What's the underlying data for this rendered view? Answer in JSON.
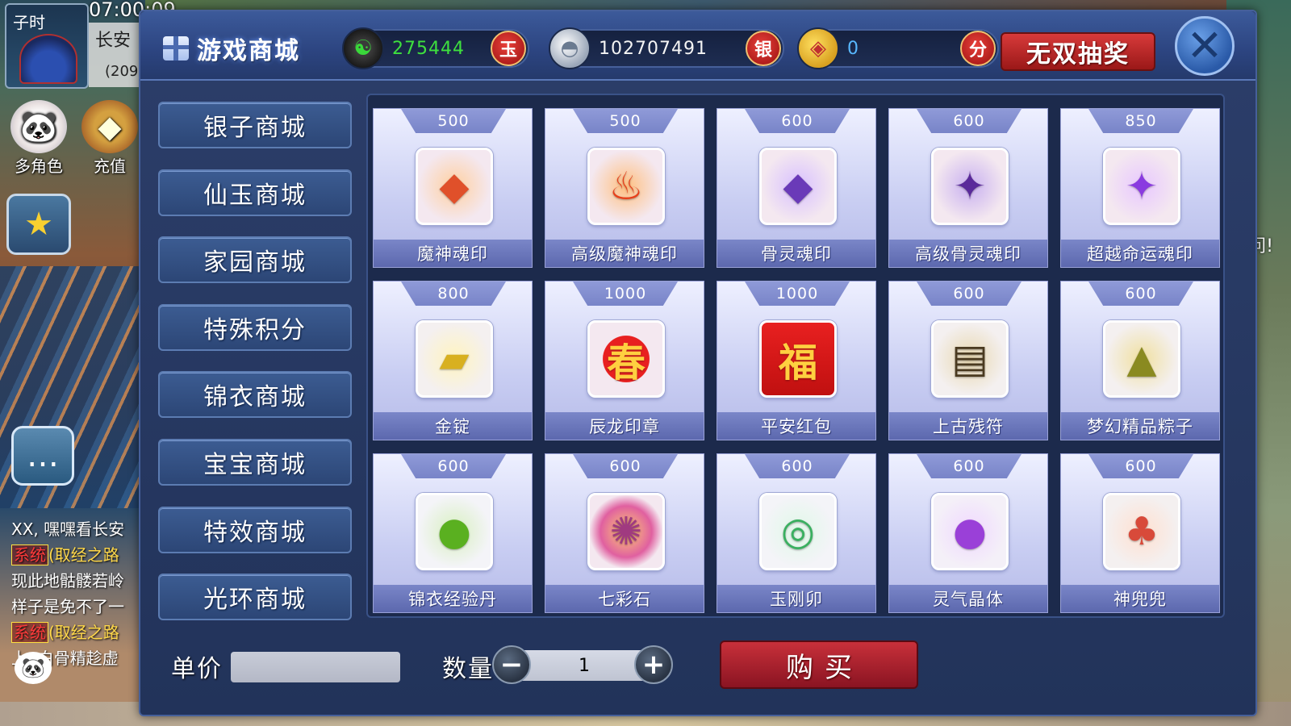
{
  "hud": {
    "time_period": "子时",
    "clock": "07:00:09",
    "city": "长安",
    "coords": "(209",
    "multi_role_label": "多角色",
    "recharge_label": "充值",
    "chat_lines": [
      {
        "text": "XX, 嘿嘿看长安"
      },
      {
        "tag": "系统",
        "text": "(取经之路"
      },
      {
        "text": "现此地骷髅若岭"
      },
      {
        "text": "样子是免不了一"
      },
      {
        "tag": "系统",
        "text": "(取经之路"
      },
      {
        "text": "上, 白骨精趁虚"
      }
    ],
    "right_text": "问!"
  },
  "mall": {
    "title": "游戏商城",
    "currencies": {
      "jade": {
        "value": "275444",
        "badge": "玉"
      },
      "silver": {
        "value": "102707491",
        "badge": "银"
      },
      "points": {
        "value": "0",
        "badge": "分"
      }
    },
    "lottery_label": "无双抽奖",
    "close_symbol": "✕",
    "nav": [
      "银子商城",
      "仙玉商城",
      "家园商城",
      "特殊积分",
      "锦衣商城",
      "宝宝商城",
      "特效商城",
      "光环商城"
    ],
    "items": [
      {
        "price": "500",
        "name": "魔神魂印",
        "icon": "red-soul-seal-icon"
      },
      {
        "price": "500",
        "name": "高级魔神魂印",
        "icon": "flame-soul-seal-icon"
      },
      {
        "price": "600",
        "name": "骨灵魂印",
        "icon": "purple-soul-seal-icon"
      },
      {
        "price": "600",
        "name": "高级骨灵魂印",
        "icon": "dark-purple-soul-seal-icon"
      },
      {
        "price": "850",
        "name": "超越命运魂印",
        "icon": "violet-soul-seal-icon"
      },
      {
        "price": "800",
        "name": "金锭",
        "icon": "gold-ingot-icon"
      },
      {
        "price": "1000",
        "name": "辰龙印章",
        "icon": "dragon-seal-icon"
      },
      {
        "price": "1000",
        "name": "平安红包",
        "icon": "red-envelope-icon"
      },
      {
        "price": "600",
        "name": "上古残符",
        "icon": "ancient-talisman-icon"
      },
      {
        "price": "600",
        "name": "梦幻精品粽子",
        "icon": "zongzi-icon"
      },
      {
        "price": "600",
        "name": "锦衣经验丹",
        "icon": "experience-pill-icon"
      },
      {
        "price": "600",
        "name": "七彩石",
        "icon": "rainbow-stone-icon"
      },
      {
        "price": "600",
        "name": "玉刚卯",
        "icon": "jade-bracelet-icon"
      },
      {
        "price": "600",
        "name": "灵气晶体",
        "icon": "purple-crystal-orb-icon"
      },
      {
        "price": "600",
        "name": "神兜兜",
        "icon": "lucky-pouch-icon"
      }
    ],
    "unit_price_label": "单价",
    "unit_price_value": "",
    "quantity_label": "数量",
    "quantity_value": "1",
    "minus_symbol": "−",
    "plus_symbol": "+",
    "buy_label": "购买"
  }
}
